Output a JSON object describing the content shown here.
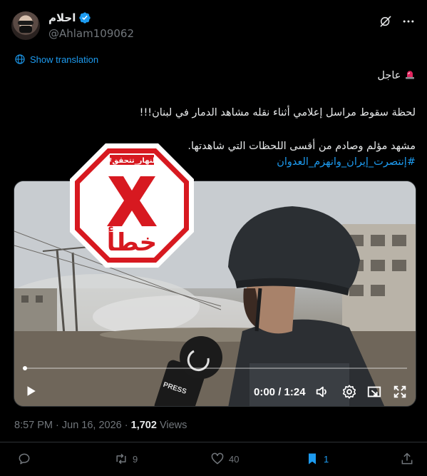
{
  "user": {
    "display_name": "احلام",
    "handle": "@Ahlam109062",
    "verified": true
  },
  "translate": {
    "label": "Show translation"
  },
  "tweet": {
    "line1": "عاجل",
    "line2": "لحظة سقوط مراسل إعلامي أثناء نقله مشاهد الدمار في لبنان!!!",
    "line3": "مشهد مؤلم وصادم من أقسى اللحظات التي شاهدتها.",
    "hashtag": "#إنتصرت_إيران_وانهزم_العدوان"
  },
  "stamp": {
    "tag": "#النهار_تتحقق",
    "verdict": "خطأ",
    "color": "#d71920"
  },
  "video": {
    "time": "0:00 / 1:24",
    "mic_label": "PRESS",
    "progress": 0.0
  },
  "meta": {
    "time": "8:57 PM · Jun 16, 2026 · ",
    "views_count": "1,702",
    "views_label": " Views"
  },
  "actions": {
    "replies": "",
    "reposts": "9",
    "likes": "40",
    "bookmarks": "1"
  },
  "colors": {
    "accent": "#1d9bf0",
    "muted": "#71767b",
    "text": "#e7e9ea",
    "background": "#000000"
  }
}
